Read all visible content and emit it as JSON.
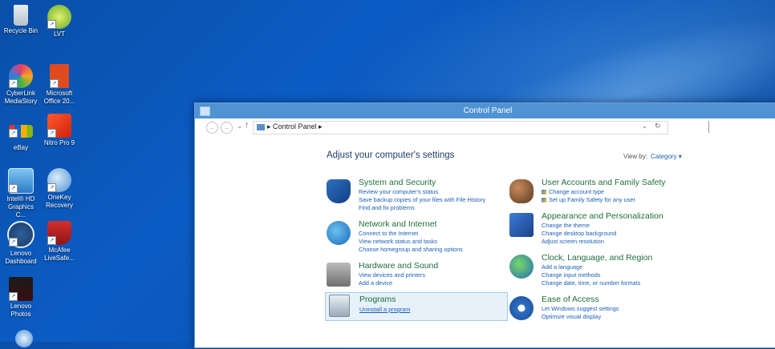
{
  "desktop": {
    "icons": [
      {
        "label": "Recycle Bin",
        "icon": "recycle-bin-icon"
      },
      {
        "label": "LVT",
        "icon": "lvt-icon"
      },
      {
        "label": "CyberLink MediaStory",
        "icon": "cyberlink-icon"
      },
      {
        "label": "Microsoft Office 20...",
        "icon": "office-icon"
      },
      {
        "label": "eBay",
        "icon": "ebay-icon"
      },
      {
        "label": "Nitro Pro 9",
        "icon": "nitro-icon"
      },
      {
        "label": "Intel® HD Graphics C...",
        "icon": "intel-graphics-icon"
      },
      {
        "label": "OneKey Recovery",
        "icon": "onekey-recovery-icon"
      },
      {
        "label": "Lenovo Dashboard",
        "icon": "lenovo-dashboard-icon"
      },
      {
        "label": "McAfee LiveSafe...",
        "icon": "mcafee-icon"
      },
      {
        "label": "Lenovo Photos",
        "icon": "lenovo-photos-icon"
      }
    ]
  },
  "window": {
    "title": "Control Panel",
    "address": {
      "breadcrumb_root": "Control Panel",
      "separator": "▸",
      "refresh_symbol": "↻",
      "dropdown_symbol": "⌄"
    },
    "heading": "Adjust your computer's settings",
    "view_by_label": "View by:",
    "view_by_value": "Category ▾",
    "categories": [
      {
        "title": "System and Security",
        "icon": "system-security-icon",
        "links": [
          "Review your computer's status",
          "Save backup copies of your files with File History",
          "Find and fix problems"
        ]
      },
      {
        "title": "Network and Internet",
        "icon": "network-icon",
        "links": [
          "Connect to the Internet",
          "View network status and tasks",
          "Choose homegroup and sharing options"
        ]
      },
      {
        "title": "Hardware and Sound",
        "icon": "hardware-sound-icon",
        "links": [
          "View devices and printers",
          "Add a device"
        ]
      },
      {
        "title": "Programs",
        "icon": "programs-icon",
        "links": [
          "Uninstall a program"
        ]
      },
      {
        "title": "User Accounts and Family Safety",
        "icon": "user-accounts-icon",
        "links": [
          "Change account type",
          "Set up Family Safety for any user"
        ]
      },
      {
        "title": "Appearance and Personalization",
        "icon": "appearance-icon",
        "links": [
          "Change the theme",
          "Change desktop background",
          "Adjust screen resolution"
        ]
      },
      {
        "title": "Clock, Language, and Region",
        "icon": "clock-region-icon",
        "links": [
          "Add a language",
          "Change input methods",
          "Change date, time, or number formats"
        ]
      },
      {
        "title": "Ease of Access",
        "icon": "ease-of-access-icon",
        "links": [
          "Let Windows suggest settings",
          "Optimize visual display"
        ]
      }
    ],
    "colors": {
      "title_bar": "#4f93d4",
      "category_title": "#1f6f3a",
      "link": "#1a5fb4",
      "heading": "#1e3d6b"
    }
  }
}
